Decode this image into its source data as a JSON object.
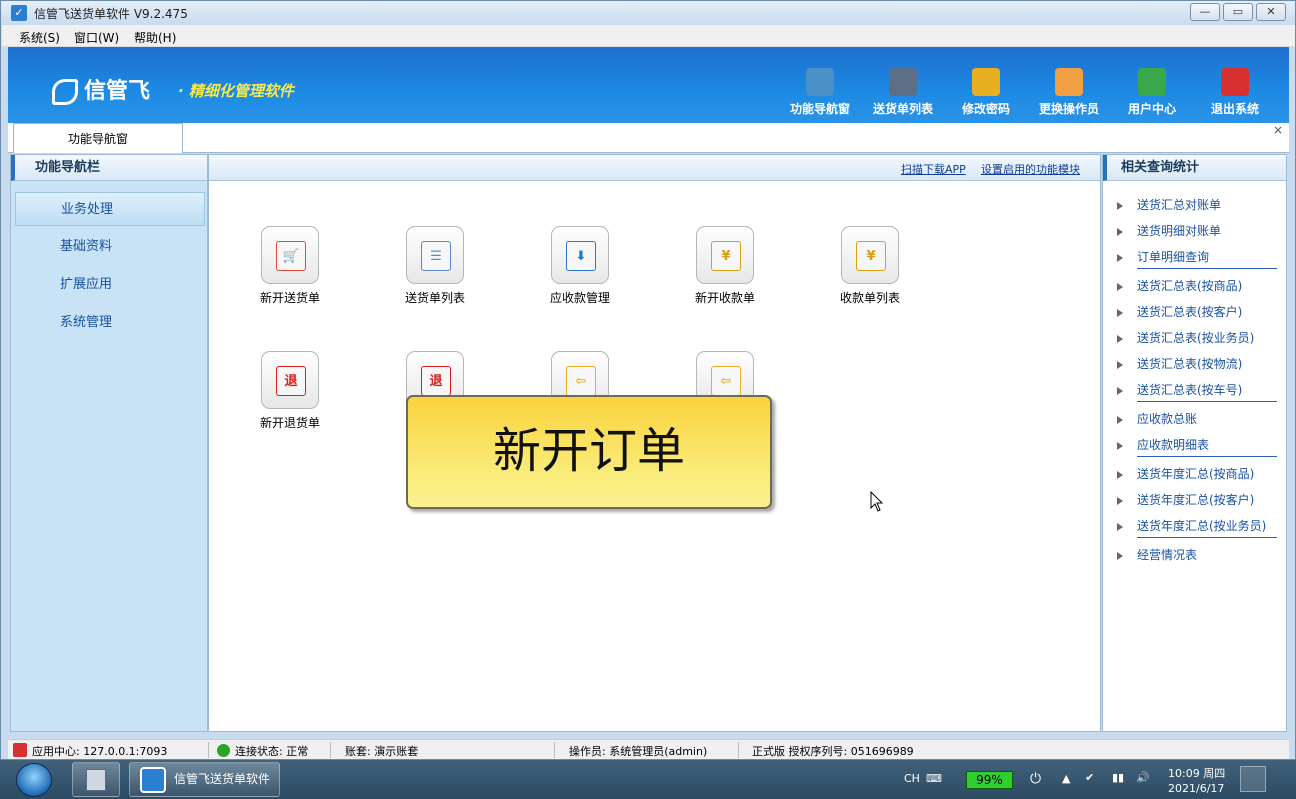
{
  "window": {
    "title": "信管飞送货单软件 V9.2.475",
    "controls": {
      "minimize": "—",
      "maximize": "▭",
      "close": "✕"
    }
  },
  "menubar": [
    "系统(S)",
    "窗口(W)",
    "帮助(H)"
  ],
  "banner": {
    "logo_text": "信管飞",
    "slogan": "· 精细化管理软件",
    "toolbar": [
      {
        "label": "功能导航窗",
        "icon": "monitor-icon",
        "color": "#4a90c8"
      },
      {
        "label": "送货单列表",
        "icon": "list-icon",
        "color": "#5b6f86"
      },
      {
        "label": "修改密码",
        "icon": "lock-icon",
        "color": "#e8b020"
      },
      {
        "label": "更换操作员",
        "icon": "user-icon",
        "color": "#f0a040"
      },
      {
        "label": "用户中心",
        "icon": "globe-icon",
        "color": "#3aa84a"
      },
      {
        "label": "退出系统",
        "icon": "power-icon",
        "color": "#d83030"
      }
    ]
  },
  "tabs": {
    "active": "功能导航窗",
    "close": "×"
  },
  "left_panel": {
    "title": "功能导航栏",
    "items": [
      "业务处理",
      "基础资料",
      "扩展应用",
      "系统管理"
    ],
    "active_index": 0
  },
  "center": {
    "links": [
      "扫描下载APP",
      "设置启用的功能模块"
    ],
    "functions_row1": [
      {
        "label": "新开送货单",
        "icon": "cart-icon",
        "glyph": "🛒",
        "color": "#e04a3a"
      },
      {
        "label": "送货单列表",
        "icon": "cart-list-icon",
        "glyph": "☰",
        "color": "#5a88c8"
      },
      {
        "label": "应收款管理",
        "icon": "receivable-icon",
        "glyph": "⬇",
        "color": "#2a78c8"
      },
      {
        "label": "新开收款单",
        "icon": "yen-notepad-icon",
        "glyph": "¥",
        "color": "#d8a010"
      },
      {
        "label": "收款单列表",
        "icon": "yen-list-icon",
        "glyph": "¥",
        "color": "#d8a010"
      }
    ],
    "functions_row2": [
      {
        "label": "新开退货单",
        "icon": "return-notepad-icon",
        "glyph": "退",
        "color": "#d82020"
      },
      {
        "label": "",
        "icon": "return-list-icon",
        "glyph": "退",
        "color": "#d82020"
      },
      {
        "label": "",
        "icon": "back-arrow-icon",
        "glyph": "⇦",
        "color": "#e8b020"
      },
      {
        "label": "",
        "icon": "back-list-icon",
        "glyph": "⇦",
        "color": "#e8b020"
      }
    ],
    "tooltip": "新开订单"
  },
  "right_panel": {
    "title": "相关查询统计",
    "groups": [
      [
        "送货汇总对账单",
        "送货明细对账单",
        "订单明细查询"
      ],
      [
        "送货汇总表(按商品)",
        "送货汇总表(按客户)",
        "送货汇总表(按业务员)",
        "送货汇总表(按物流)",
        "送货汇总表(按车号)"
      ],
      [
        "应收款总账",
        "应收款明细表"
      ],
      [
        "送货年度汇总(按商品)",
        "送货年度汇总(按客户)",
        "送货年度汇总(按业务员)"
      ],
      [
        "经营情况表"
      ]
    ]
  },
  "statusbar": {
    "app_center": "应用中心: 127.0.0.1:7093",
    "connection": "连接状态: 正常",
    "account": "账套: 演示账套",
    "operator": "操作员: 系统管理员(admin)",
    "license": "正式版 授权序列号: 051696989"
  },
  "taskbar": {
    "app_label": "信管飞送货单软件",
    "lang": "CH",
    "battery": "99%",
    "time": "10:09 周四",
    "date": "2021/6/17"
  }
}
